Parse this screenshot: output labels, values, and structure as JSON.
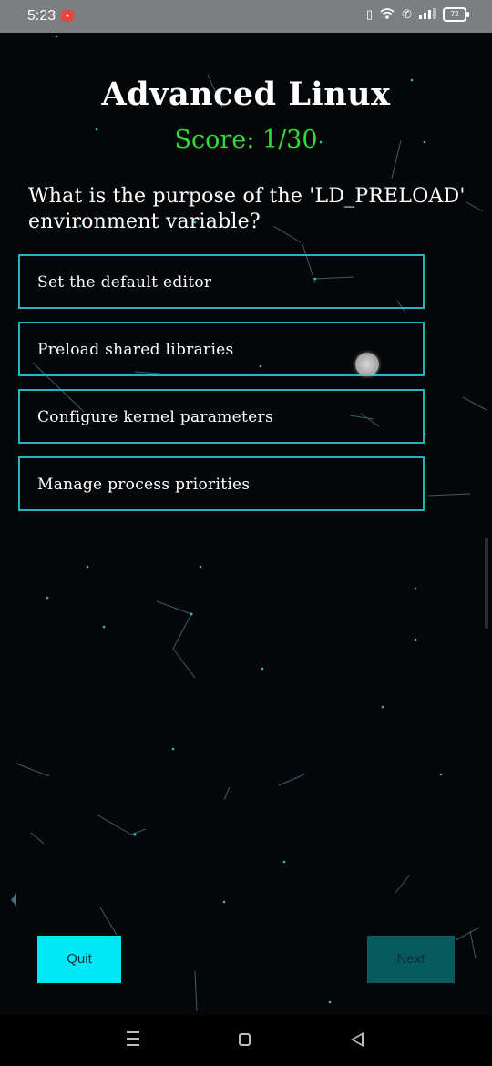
{
  "status": {
    "time": "5:23",
    "rec_label": "●",
    "battery": "72"
  },
  "quiz": {
    "title": "Advanced Linux",
    "score": "Score: 1/30",
    "question": "What is the purpose of the 'LD_PRELOAD' environment variable?",
    "options": [
      "Set the default editor",
      "Preload shared libraries",
      "Configure kernel parameters",
      "Manage process priorities"
    ]
  },
  "buttons": {
    "quit": "Quit",
    "next": "Next"
  },
  "colors": {
    "accent": "#00e8f5",
    "option_border": "#1fb8c1",
    "score": "#36d93a",
    "next_disabled": "#075b5f"
  }
}
